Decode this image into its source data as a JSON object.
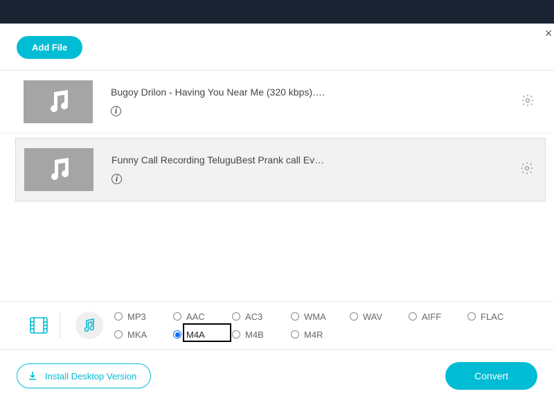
{
  "toolbar": {
    "add_file": "Add File"
  },
  "files": [
    {
      "title": "Bugoy Drilon - Having You Near Me (320 kbps)…."
    },
    {
      "title": "Funny Call Recording TeluguBest Prank call Ev…"
    }
  ],
  "formats": {
    "row1": [
      "MP3",
      "AAC",
      "AC3",
      "WMA",
      "WAV",
      "AIFF",
      "FLAC"
    ],
    "row2": [
      "MKA",
      "M4A",
      "M4B",
      "M4R"
    ],
    "selected": "M4A"
  },
  "footer": {
    "install": "Install Desktop Version",
    "convert": "Convert"
  }
}
